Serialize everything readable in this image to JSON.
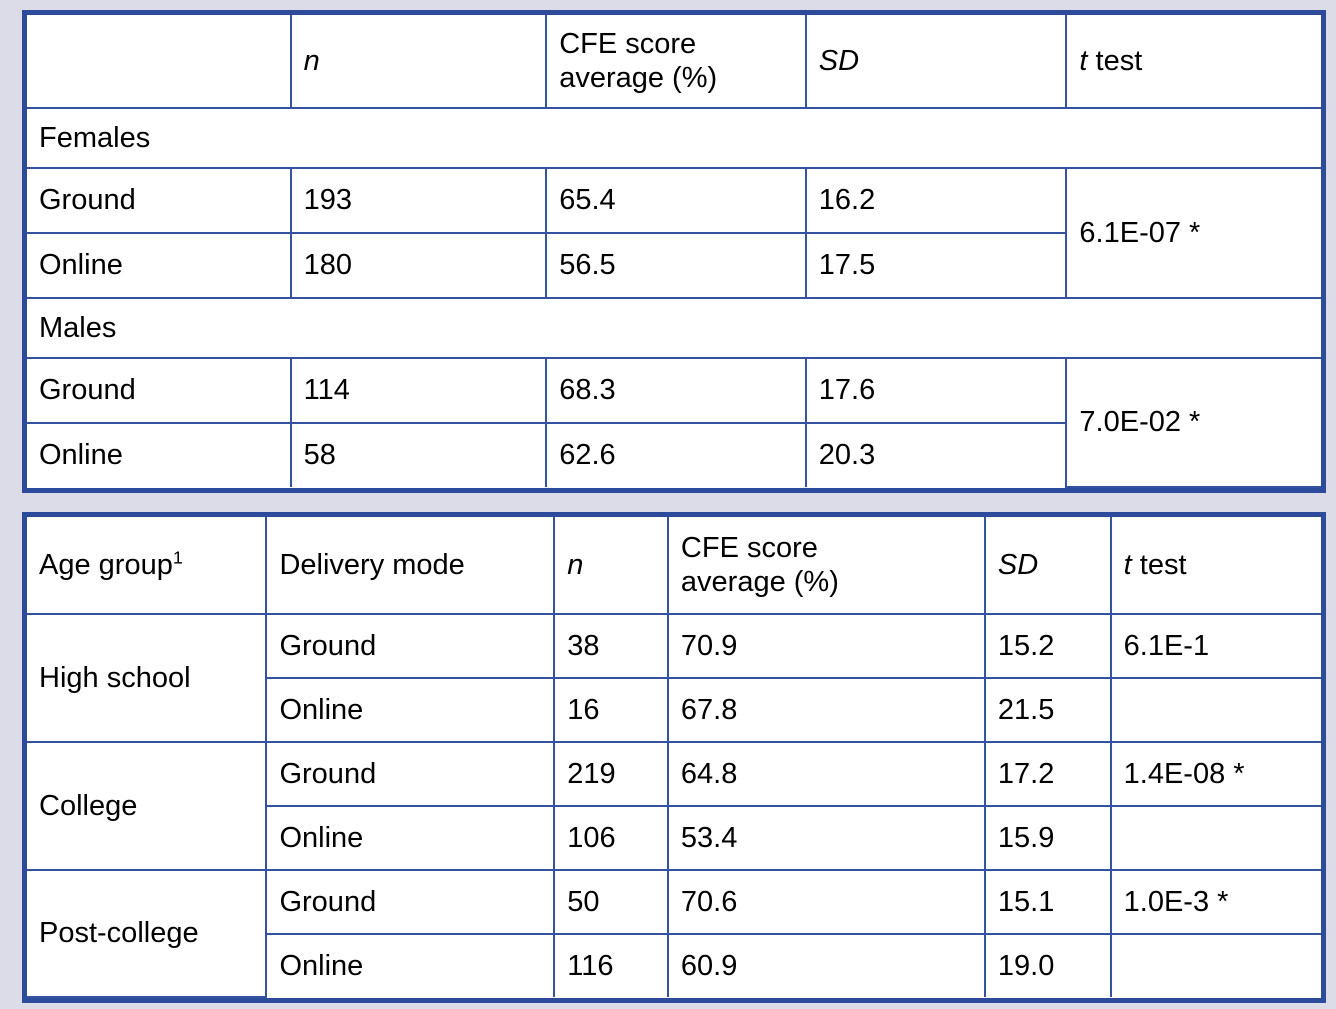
{
  "colors": {
    "page_background": "#dcdce9",
    "table_outer_border": "#2c4b9b",
    "table_inner_border": "#33539e",
    "cell_background": "#ffffff",
    "text": "#000000"
  },
  "table_sex": {
    "headers": {
      "label": "",
      "n": "n",
      "cfe": "CFE score average (%)",
      "cfe_line1": "CFE score",
      "cfe_line2": "average (%)",
      "sd": "SD",
      "t_italic": "t",
      "t_rest": "test"
    },
    "banner_females": "Females",
    "banner_males": "Males",
    "groups": [
      {
        "banner": "Females",
        "rows": [
          {
            "label": "Ground",
            "n": "193",
            "cfe": "65.4",
            "sd": "16.2"
          },
          {
            "label": "Online",
            "n": "180",
            "cfe": "56.5",
            "sd": "17.5"
          }
        ],
        "t_test": "6.1E-07 *"
      },
      {
        "banner": "Males",
        "rows": [
          {
            "label": "Ground",
            "n": "114",
            "cfe": "68.3",
            "sd": "17.6"
          },
          {
            "label": "Online",
            "n": "58",
            "cfe": "62.6",
            "sd": "20.3"
          }
        ],
        "t_test": "7.0E-02 *"
      }
    ]
  },
  "table_age": {
    "headers": {
      "age_group": "Age group",
      "age_group_superscript": "1",
      "delivery_mode": "Delivery mode",
      "n": "n",
      "cfe_line1": "CFE score",
      "cfe_line2": "average (%)",
      "sd": "SD",
      "t_italic": "t",
      "t_rest": "test"
    },
    "groups": [
      {
        "age_group": "High school",
        "rows": [
          {
            "mode": "Ground",
            "n": "38",
            "cfe": "70.9",
            "sd": "15.2",
            "t_test": "6.1E-1"
          },
          {
            "mode": "Online",
            "n": "16",
            "cfe": "67.8",
            "sd": "21.5",
            "t_test": ""
          }
        ]
      },
      {
        "age_group": "College",
        "rows": [
          {
            "mode": "Ground",
            "n": "219",
            "cfe": "64.8",
            "sd": "17.2",
            "t_test": "1.4E-08 *"
          },
          {
            "mode": "Online",
            "n": "106",
            "cfe": "53.4",
            "sd": "15.9",
            "t_test": ""
          }
        ]
      },
      {
        "age_group": "Post-college",
        "rows": [
          {
            "mode": "Ground",
            "n": "50",
            "cfe": "70.6",
            "sd": "15.1",
            "t_test": "1.0E-3 *"
          },
          {
            "mode": "Online",
            "n": "116",
            "cfe": "60.9",
            "sd": "19.0",
            "t_test": ""
          }
        ]
      }
    ]
  }
}
